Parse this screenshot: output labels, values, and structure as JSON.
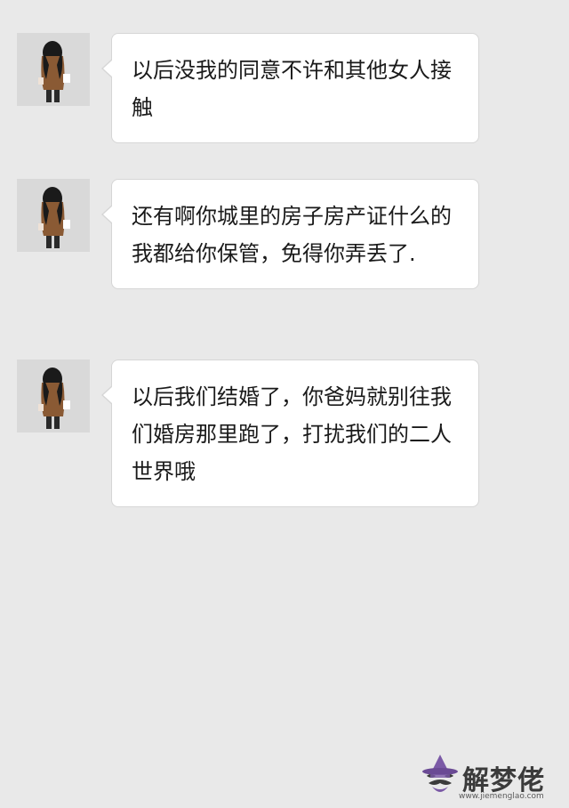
{
  "chat": {
    "messages": [
      {
        "sender": "other",
        "text": "以后没我的同意不许和其他女人接触"
      },
      {
        "sender": "other",
        "text": "还有啊你城里的房子房产证什么的我都给你保管，免得你弄丢了."
      },
      {
        "sender": "other",
        "text": "以后我们结婚了，你爸妈就别往我们婚房那里跑了，打扰我们的二人世界哦"
      }
    ]
  },
  "watermark": {
    "title": "解梦佬",
    "url": "www.jiemenglao.com",
    "icon": "wizard-hat-mustache-icon"
  },
  "colors": {
    "background": "#e9e9e9",
    "bubble": "#ffffff",
    "bubble_border": "#d6d6d6",
    "text": "#1a1a1a",
    "watermark_accent": "#7b5aa6"
  }
}
